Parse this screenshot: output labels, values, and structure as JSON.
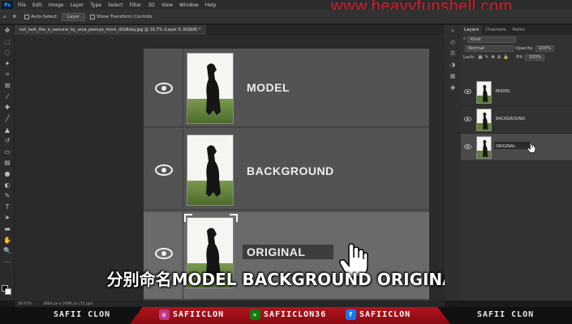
{
  "app": {
    "logo": "Ps",
    "menu": [
      "File",
      "Edit",
      "Image",
      "Layer",
      "Type",
      "Select",
      "Filter",
      "3D",
      "View",
      "Window",
      "Help"
    ]
  },
  "watermark": "www.heavyfunshell.com",
  "options_bar": {
    "auto_select_label": "Auto-Select:",
    "auto_select_value": "Layer",
    "transform_label": "Show Transform Controls"
  },
  "document_tab": "not_look_like_a_samurai_by_arya_poenya_stock_d1b8xby.jpg @ 16.7% (Layer 0, RGB/8) *",
  "zoom_rows": [
    {
      "label": "MODEL"
    },
    {
      "label": "BACKGROUND"
    },
    {
      "label": "ORIGINAL"
    }
  ],
  "subtitle": "分别命名MODEL BACKGROUND ORIGINAL",
  "layers_panel": {
    "tabs": [
      "Layers",
      "Channels",
      "Paths"
    ],
    "kind_filter": "Kind",
    "blend_mode": "Normal",
    "opacity_label": "Opacity:",
    "opacity_value": "100%",
    "lock_label": "Lock:",
    "fill_label": "Fill:",
    "fill_value": "100%",
    "layers": [
      {
        "name": "MODEL",
        "selected": false
      },
      {
        "name": "BACKGROUND",
        "selected": false
      },
      {
        "name": "ORIGINAL",
        "selected": true
      }
    ]
  },
  "status_bar": {
    "zoom": "16.67%",
    "doc_info": "3664 px x 2496 px (72 ppi)"
  },
  "footer": {
    "left_name": "SAFII CLON",
    "right_name": "SAFII CLON",
    "socials": [
      {
        "icon": "instagram-icon",
        "handle": "SAFIICLON",
        "color": "#c13584"
      },
      {
        "icon": "xbox-icon",
        "handle": "SAFIICLON36",
        "color": "#107c10"
      },
      {
        "icon": "facebook-icon",
        "handle": "SAFIICLON",
        "color": "#1877f2"
      }
    ]
  },
  "colors": {
    "accent_red": "#b0141e",
    "ps_blue": "#31a8ff"
  }
}
